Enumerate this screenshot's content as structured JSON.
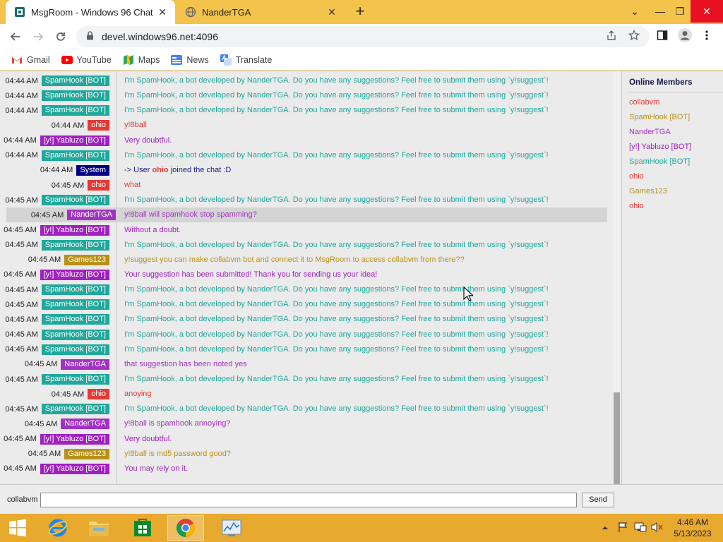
{
  "browser": {
    "tabs": [
      {
        "title": "MsgRoom - Windows 96 Chat",
        "close": "✕",
        "active": true
      },
      {
        "title": "NanderTGA",
        "close": "✕",
        "active": false
      }
    ],
    "new_tab": "+",
    "window_controls": {
      "tab_search": "⌄",
      "minimize": "—",
      "maximize": "❐",
      "close": "✕"
    },
    "address": {
      "url": "devel.windows96.net:4096"
    },
    "bookmarks": [
      {
        "label": "Gmail",
        "icon": "gmail-icon"
      },
      {
        "label": "YouTube",
        "icon": "youtube-icon"
      },
      {
        "label": "Maps",
        "icon": "maps-icon"
      },
      {
        "label": "News",
        "icon": "news-icon"
      },
      {
        "label": "Translate",
        "icon": "translate-icon"
      }
    ]
  },
  "chat": {
    "user_colors": {
      "SpamHook [BOT]": "#1fa89b",
      "ohio": "#e53935",
      "[y!] Yabluzo [BOT]": "#a020c0",
      "System": "#000080",
      "NanderTGA": "#a233c2",
      "Games123": "#b8901a"
    },
    "messages": [
      {
        "time": "04:44 AM",
        "user": "SpamHook [BOT]",
        "text": "I'm SpamHook, a bot developed by NanderTGA. Do you have any suggestions? Feel free to submit them using `y!suggest`!"
      },
      {
        "time": "04:44 AM",
        "user": "SpamHook [BOT]",
        "text": "I'm SpamHook, a bot developed by NanderTGA. Do you have any suggestions? Feel free to submit them using `y!suggest`!"
      },
      {
        "time": "04:44 AM",
        "user": "SpamHook [BOT]",
        "text": "I'm SpamHook, a bot developed by NanderTGA. Do you have any suggestions? Feel free to submit them using `y!suggest`!"
      },
      {
        "time": "04:44 AM",
        "user": "ohio",
        "text": "y!8ball"
      },
      {
        "time": "04:44 AM",
        "user": "[y!] Yabluzo [BOT]",
        "text": "Very doubtful."
      },
      {
        "time": "04:44 AM",
        "user": "SpamHook [BOT]",
        "text": "I'm SpamHook, a bot developed by NanderTGA. Do you have any suggestions? Feel free to submit them using `y!suggest`!"
      },
      {
        "time": "04:44 AM",
        "user": "System",
        "system": true,
        "text_pre": "-> User ",
        "text_user": "ohio",
        "text_post": " joined the chat :D"
      },
      {
        "time": "04:45 AM",
        "user": "ohio",
        "text": "what"
      },
      {
        "time": "04:45 AM",
        "user": "SpamHook [BOT]",
        "text": "I'm SpamHook, a bot developed by NanderTGA. Do you have any suggestions? Feel free to submit them using `y!suggest`!"
      },
      {
        "time": "04:45 AM",
        "user": "NanderTGA",
        "text": "y!8ball will spamhook stop spamming?",
        "highlighted": true
      },
      {
        "time": "04:45 AM",
        "user": "[y!] Yabluzo [BOT]",
        "text": "Without a doubt."
      },
      {
        "time": "04:45 AM",
        "user": "SpamHook [BOT]",
        "text": "I'm SpamHook, a bot developed by NanderTGA. Do you have any suggestions? Feel free to submit them using `y!suggest`!"
      },
      {
        "time": "04:45 AM",
        "user": "Games123",
        "text": "y!suggest you can make collabvm bot and connect it to MsgRoom to access collabvm from there??"
      },
      {
        "time": "04:45 AM",
        "user": "[y!] Yabluzo [BOT]",
        "text": "Your suggestion has been submitted! Thank you for sending us your idea!"
      },
      {
        "time": "04:45 AM",
        "user": "SpamHook [BOT]",
        "text": "I'm SpamHook, a bot developed by NanderTGA. Do you have any suggestions? Feel free to submit them using `y!suggest`!"
      },
      {
        "time": "04:45 AM",
        "user": "SpamHook [BOT]",
        "text": "I'm SpamHook, a bot developed by NanderTGA. Do you have any suggestions? Feel free to submit them using `y!suggest`!"
      },
      {
        "time": "04:45 AM",
        "user": "SpamHook [BOT]",
        "text": "I'm SpamHook, a bot developed by NanderTGA. Do you have any suggestions? Feel free to submit them using `y!suggest`!"
      },
      {
        "time": "04:45 AM",
        "user": "SpamHook [BOT]",
        "text": "I'm SpamHook, a bot developed by NanderTGA. Do you have any suggestions? Feel free to submit them using `y!suggest`!"
      },
      {
        "time": "04:45 AM",
        "user": "SpamHook [BOT]",
        "text": "I'm SpamHook, a bot developed by NanderTGA. Do you have any suggestions? Feel free to submit them using `y!suggest`!"
      },
      {
        "time": "04:45 AM",
        "user": "NanderTGA",
        "text": "that suggestion has been noted yes"
      },
      {
        "time": "04:45 AM",
        "user": "SpamHook [BOT]",
        "text": "I'm SpamHook, a bot developed by NanderTGA. Do you have any suggestions? Feel free to submit them using `y!suggest`!"
      },
      {
        "time": "04:45 AM",
        "user": "ohio",
        "text": "anoying"
      },
      {
        "time": "04:45 AM",
        "user": "SpamHook [BOT]",
        "text": "I'm SpamHook, a bot developed by NanderTGA. Do you have any suggestions? Feel free to submit them using `y!suggest`!"
      },
      {
        "time": "04:45 AM",
        "user": "NanderTGA",
        "text": "y!8ball is spamhook annoying?"
      },
      {
        "time": "04:45 AM",
        "user": "[y!] Yabluzo [BOT]",
        "text": "Very doubtful."
      },
      {
        "time": "04:45 AM",
        "user": "Games123",
        "text": "y!8ball is md5 password good?"
      },
      {
        "time": "04:45 AM",
        "user": "[y!] Yabluzo [BOT]",
        "text": "You may rely on it."
      }
    ]
  },
  "members": {
    "title": "Online Members",
    "list": [
      {
        "name": "collabvm",
        "color": "#e53935"
      },
      {
        "name": "SpamHook [BOT]",
        "color": "#b8901a"
      },
      {
        "name": "NanderTGA",
        "color": "#a233c2"
      },
      {
        "name": "[y!] Yabluzo [BOT]",
        "color": "#a020c0"
      },
      {
        "name": "SpamHook [BOT]",
        "color": "#1fa89b"
      },
      {
        "name": "ohio",
        "color": "#e53935"
      },
      {
        "name": "Games123",
        "color": "#b8901a"
      },
      {
        "name": "ohio",
        "color": "#e53935"
      }
    ]
  },
  "composer": {
    "nickname": "collabvm",
    "input_value": "",
    "send_label": "Send"
  },
  "taskbar": {
    "apps": [
      {
        "name": "internet-explorer-icon",
        "active": false
      },
      {
        "name": "file-explorer-icon",
        "active": false
      },
      {
        "name": "store-icon",
        "active": false
      },
      {
        "name": "chrome-icon",
        "active": true
      },
      {
        "name": "task-manager-icon",
        "active": false
      }
    ],
    "clock": {
      "time": "4:46 AM",
      "date": "5/13/2023"
    }
  }
}
